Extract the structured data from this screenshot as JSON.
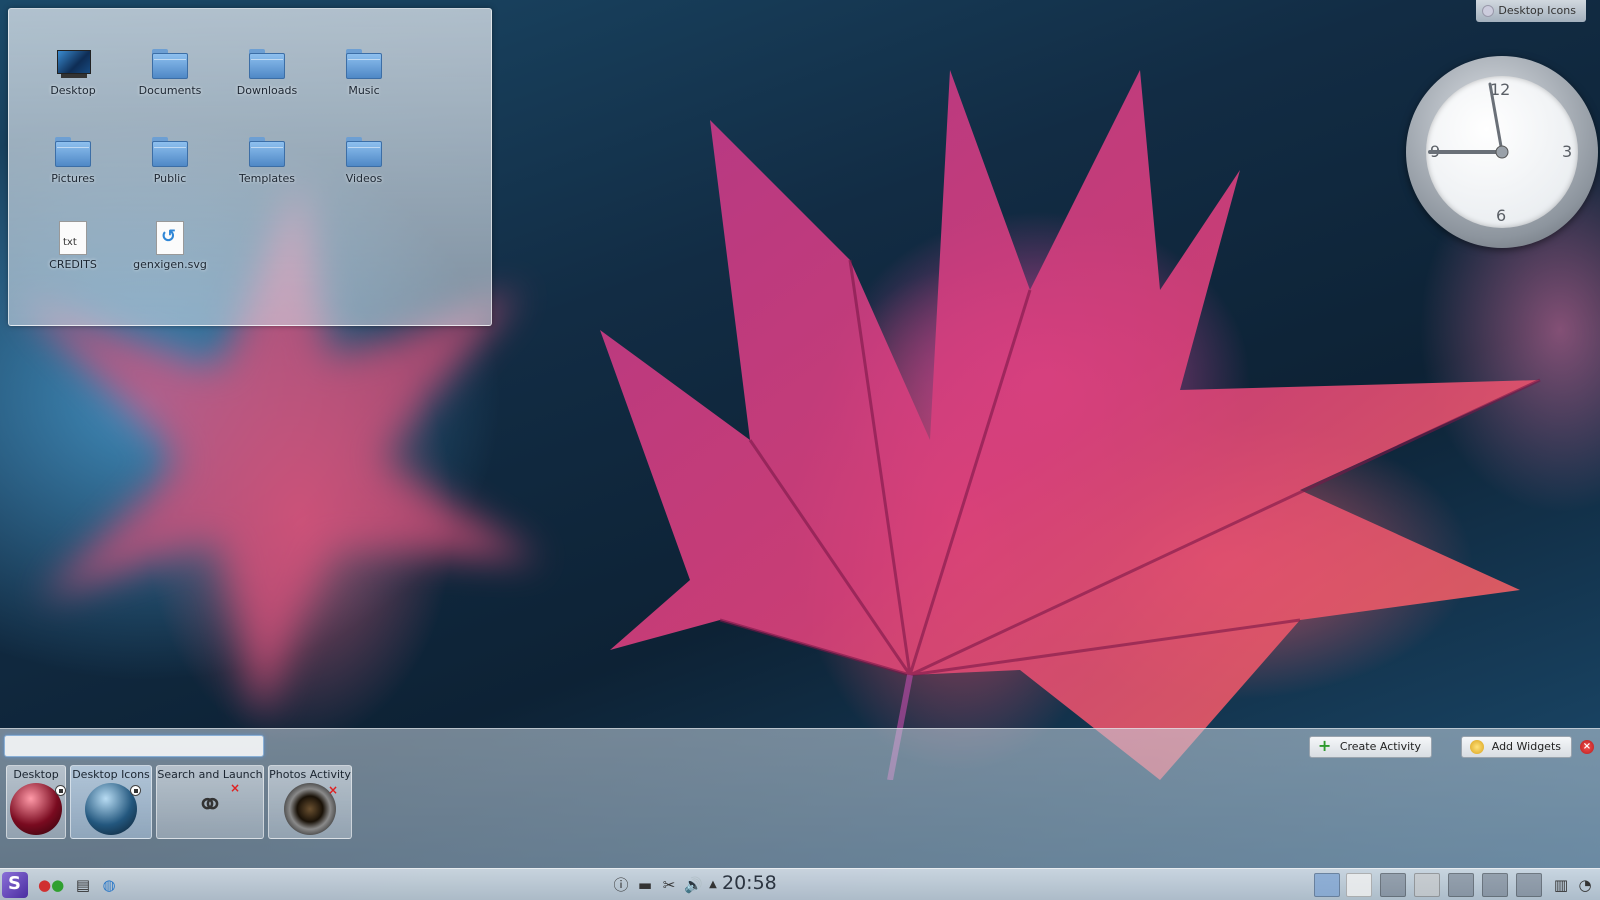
{
  "corner_tab": {
    "label": "Desktop Icons"
  },
  "folderview": {
    "items": [
      {
        "label": "Desktop",
        "icon": "desktop-icon"
      },
      {
        "label": "Documents",
        "icon": "folder-icon"
      },
      {
        "label": "Downloads",
        "icon": "folder-icon"
      },
      {
        "label": "Music",
        "icon": "folder-icon"
      },
      {
        "label": "Pictures",
        "icon": "folder-icon"
      },
      {
        "label": "Public",
        "icon": "folder-icon"
      },
      {
        "label": "Templates",
        "icon": "folder-icon"
      },
      {
        "label": "Videos",
        "icon": "folder-icon"
      },
      {
        "label": "CREDITS",
        "icon": "text-file-icon",
        "badge": "txt"
      },
      {
        "label": "genxigen.svg",
        "icon": "svg-file-icon"
      }
    ]
  },
  "clock": {
    "numbers": [
      "12",
      "3",
      "6",
      "9"
    ]
  },
  "activity_manager": {
    "search_placeholder": "",
    "create_label": "Create Activity",
    "add_widgets_label": "Add Widgets",
    "activities": [
      {
        "label": "Desktop"
      },
      {
        "label": "Desktop Icons"
      },
      {
        "label": "Search and Launch"
      },
      {
        "label": "Photos Activity"
      }
    ]
  },
  "taskbar": {
    "time": "20:58"
  },
  "colors": {
    "accent": "#4f88c6",
    "close_red": "#e02020"
  }
}
